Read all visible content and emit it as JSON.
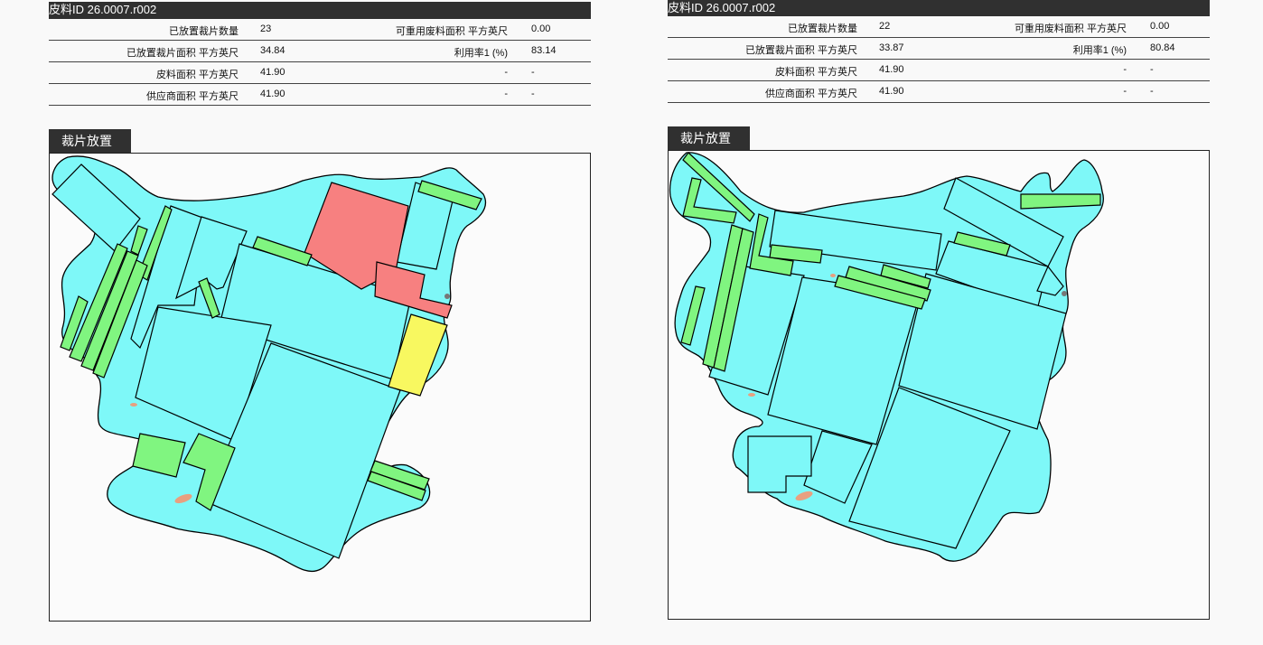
{
  "colors": {
    "hide": "#7ef8f8",
    "piece_green": "#80f580",
    "piece_red": "#f78080",
    "piece_yellow": "#f8f860",
    "defect": "#e8a080",
    "header_bg": "#303030"
  },
  "reports": [
    {
      "hide_title": "皮料ID 26.0007.r002",
      "stats": [
        {
          "label1": "已放置裁片数量",
          "value1": "23",
          "label2": "可重用废料面积 平方英尺",
          "value2": "0.00"
        },
        {
          "label1": "已放置裁片面积 平方英尺",
          "value1": "34.84",
          "label2": "利用率1 (%)",
          "value2": "83.14"
        },
        {
          "label1": "皮料面积 平方英尺",
          "value1": "41.90",
          "label2": "-",
          "value2": "-"
        },
        {
          "label1": "供应商面积 平方英尺",
          "value1": "41.90",
          "label2": "-",
          "value2": "-"
        }
      ],
      "tab_label": "裁片放置"
    },
    {
      "hide_title": "皮料ID 26.0007.r002",
      "stats": [
        {
          "label1": "已放置裁片数量",
          "value1": "22",
          "label2": "可重用废料面积 平方英尺",
          "value2": "0.00"
        },
        {
          "label1": "已放置裁片面积 平方英尺",
          "value1": "33.87",
          "label2": "利用率1 (%)",
          "value2": "80.84"
        },
        {
          "label1": "皮料面积 平方英尺",
          "value1": "41.90",
          "label2": "-",
          "value2": "-"
        },
        {
          "label1": "供应商面积 平方英尺",
          "value1": "41.90",
          "label2": "-",
          "value2": "-"
        }
      ],
      "tab_label": "裁片放置"
    }
  ]
}
